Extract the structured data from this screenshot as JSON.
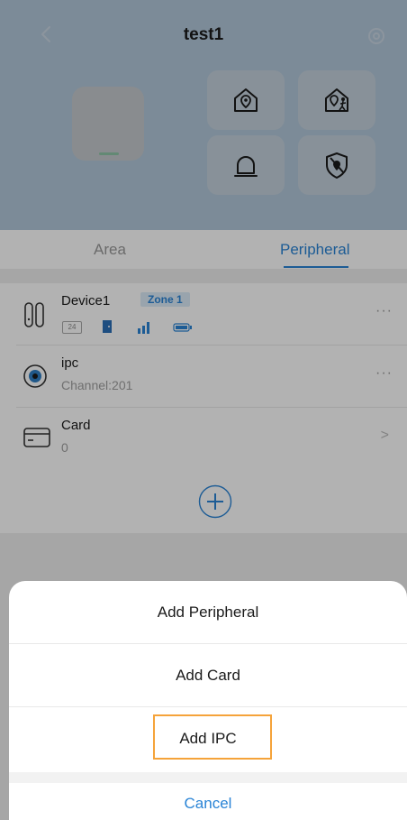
{
  "header": {
    "title": "test1",
    "icons": [
      "chevron-left-icon",
      "settings-icon",
      "hub-device",
      "home-arm-icon",
      "home-stay-icon",
      "alarm-bell-icon",
      "disarm-shield-icon"
    ],
    "background_color": "#b2c7da"
  },
  "tabs": [
    {
      "label": "Area",
      "active": false
    },
    {
      "label": "Peripheral",
      "active": true
    }
  ],
  "peripherals": {
    "device": {
      "name": "Device1",
      "zone": "Zone 1",
      "status_badge": "24",
      "status_icons": [
        "door-icon",
        "signal-icon",
        "battery-icon"
      ]
    },
    "ipc": {
      "name": "ipc",
      "channel": "Channel:201"
    },
    "card": {
      "name": "Card",
      "count": "0"
    },
    "more_label": "···",
    "chevron_label": ">"
  },
  "add_button_label": "+",
  "action_sheet": {
    "items": [
      {
        "label": "Add Peripheral"
      },
      {
        "label": "Add Card"
      },
      {
        "label": "Add IPC",
        "highlighted": true
      }
    ],
    "cancel_label": "Cancel"
  },
  "colors": {
    "accent": "#2a84d6",
    "highlight_border": "#f5a33a",
    "overlay": "rgba(0,0,0,0.30)"
  }
}
